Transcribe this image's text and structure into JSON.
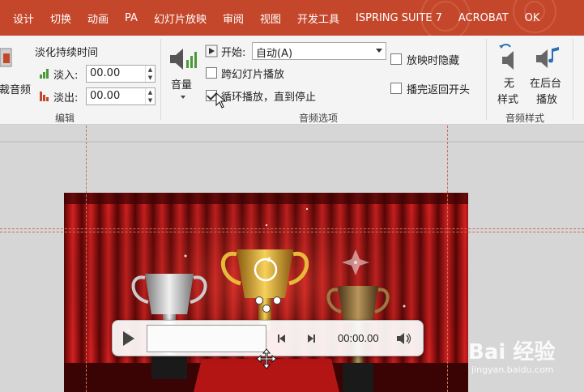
{
  "tabs": [
    "设计",
    "切换",
    "动画",
    "PA",
    "幻灯片放映",
    "审阅",
    "视图",
    "开发工具",
    "ISPRING SUITE 7",
    "ACROBAT",
    "OK"
  ],
  "edit_group": {
    "left_cut_label": "剪裁音频",
    "fade_title": "淡化持续时间",
    "fade_in_label": "淡入:",
    "fade_in_value": "00.00",
    "fade_out_label": "淡出:",
    "fade_out_value": "00.00",
    "group_label": "编辑"
  },
  "audio_options": {
    "volume_label": "音量",
    "start_label": "开始:",
    "start_value": "自动(A)",
    "cross_slides_label": "跨幻灯片播放",
    "loop_label": "循环播放，直到停止",
    "hide_label": "放映时隐藏",
    "rewind_label": "播完返回开头",
    "group_label": "音频选项",
    "loop_checked": true,
    "cross_checked": false,
    "hide_checked": false,
    "rewind_checked": false
  },
  "audio_styles": {
    "no_style_line1": "无",
    "no_style_line2": "样式",
    "bg_play_line1": "在后台",
    "bg_play_line2": "播放",
    "group_label": "音频样式"
  },
  "player": {
    "time": "00:00.00"
  },
  "watermark": {
    "brand": "Bai 经验",
    "url": "jingyan.baidu.com"
  },
  "colors": {
    "accent": "#c4472b",
    "ribbon_bg": "#f4f4f4",
    "canvas_bg": "#d6d6d6",
    "slide_red": "#8b0c0c",
    "gold": "#d9a521"
  }
}
